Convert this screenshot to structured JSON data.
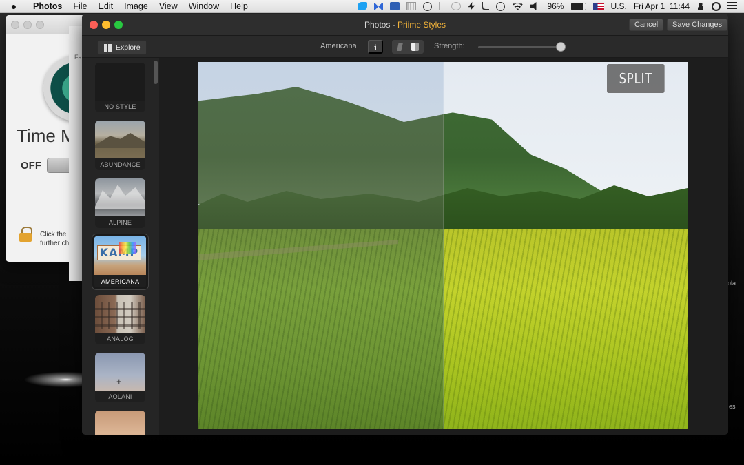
{
  "menubar": {
    "app_name": "Photos",
    "items": [
      "File",
      "Edit",
      "Image",
      "View",
      "Window",
      "Help"
    ],
    "battery": "96%",
    "input_source": "U.S.",
    "datetime": "Fri Apr 1  11:44"
  },
  "background_window": {
    "title": "Time M",
    "toggle_label": "OFF",
    "lock_text_1": "Click the",
    "lock_text_2": "further ch",
    "partial_label": "Fa"
  },
  "background_side_labels": [
    "ola",
    "es"
  ],
  "window": {
    "title_prefix": "Photos - ",
    "title_highlight": "Priime Styles",
    "cancel_label": "Cancel",
    "save_label": "Save Changes"
  },
  "toolbar": {
    "explore_label": "Explore",
    "style_name": "Americana",
    "info_label": "i",
    "strength_label": "Strength:",
    "strength_value": 1.0
  },
  "styles": [
    {
      "label": "NO STYLE",
      "selected": false
    },
    {
      "label": "ABUNDANCE",
      "selected": false
    },
    {
      "label": "ALPINE",
      "selected": false
    },
    {
      "label": "AMERICANA",
      "selected": true,
      "sign_text": "KAMP"
    },
    {
      "label": "ANALOG",
      "selected": false
    },
    {
      "label": "AOLANI",
      "selected": false
    }
  ],
  "canvas": {
    "split_label": "SPLIT"
  },
  "colors": {
    "accent": "#f2b33a",
    "window_bg": "#252525",
    "close": "#fc5f57",
    "minimize": "#fdbc2e",
    "maximize": "#28c840"
  }
}
